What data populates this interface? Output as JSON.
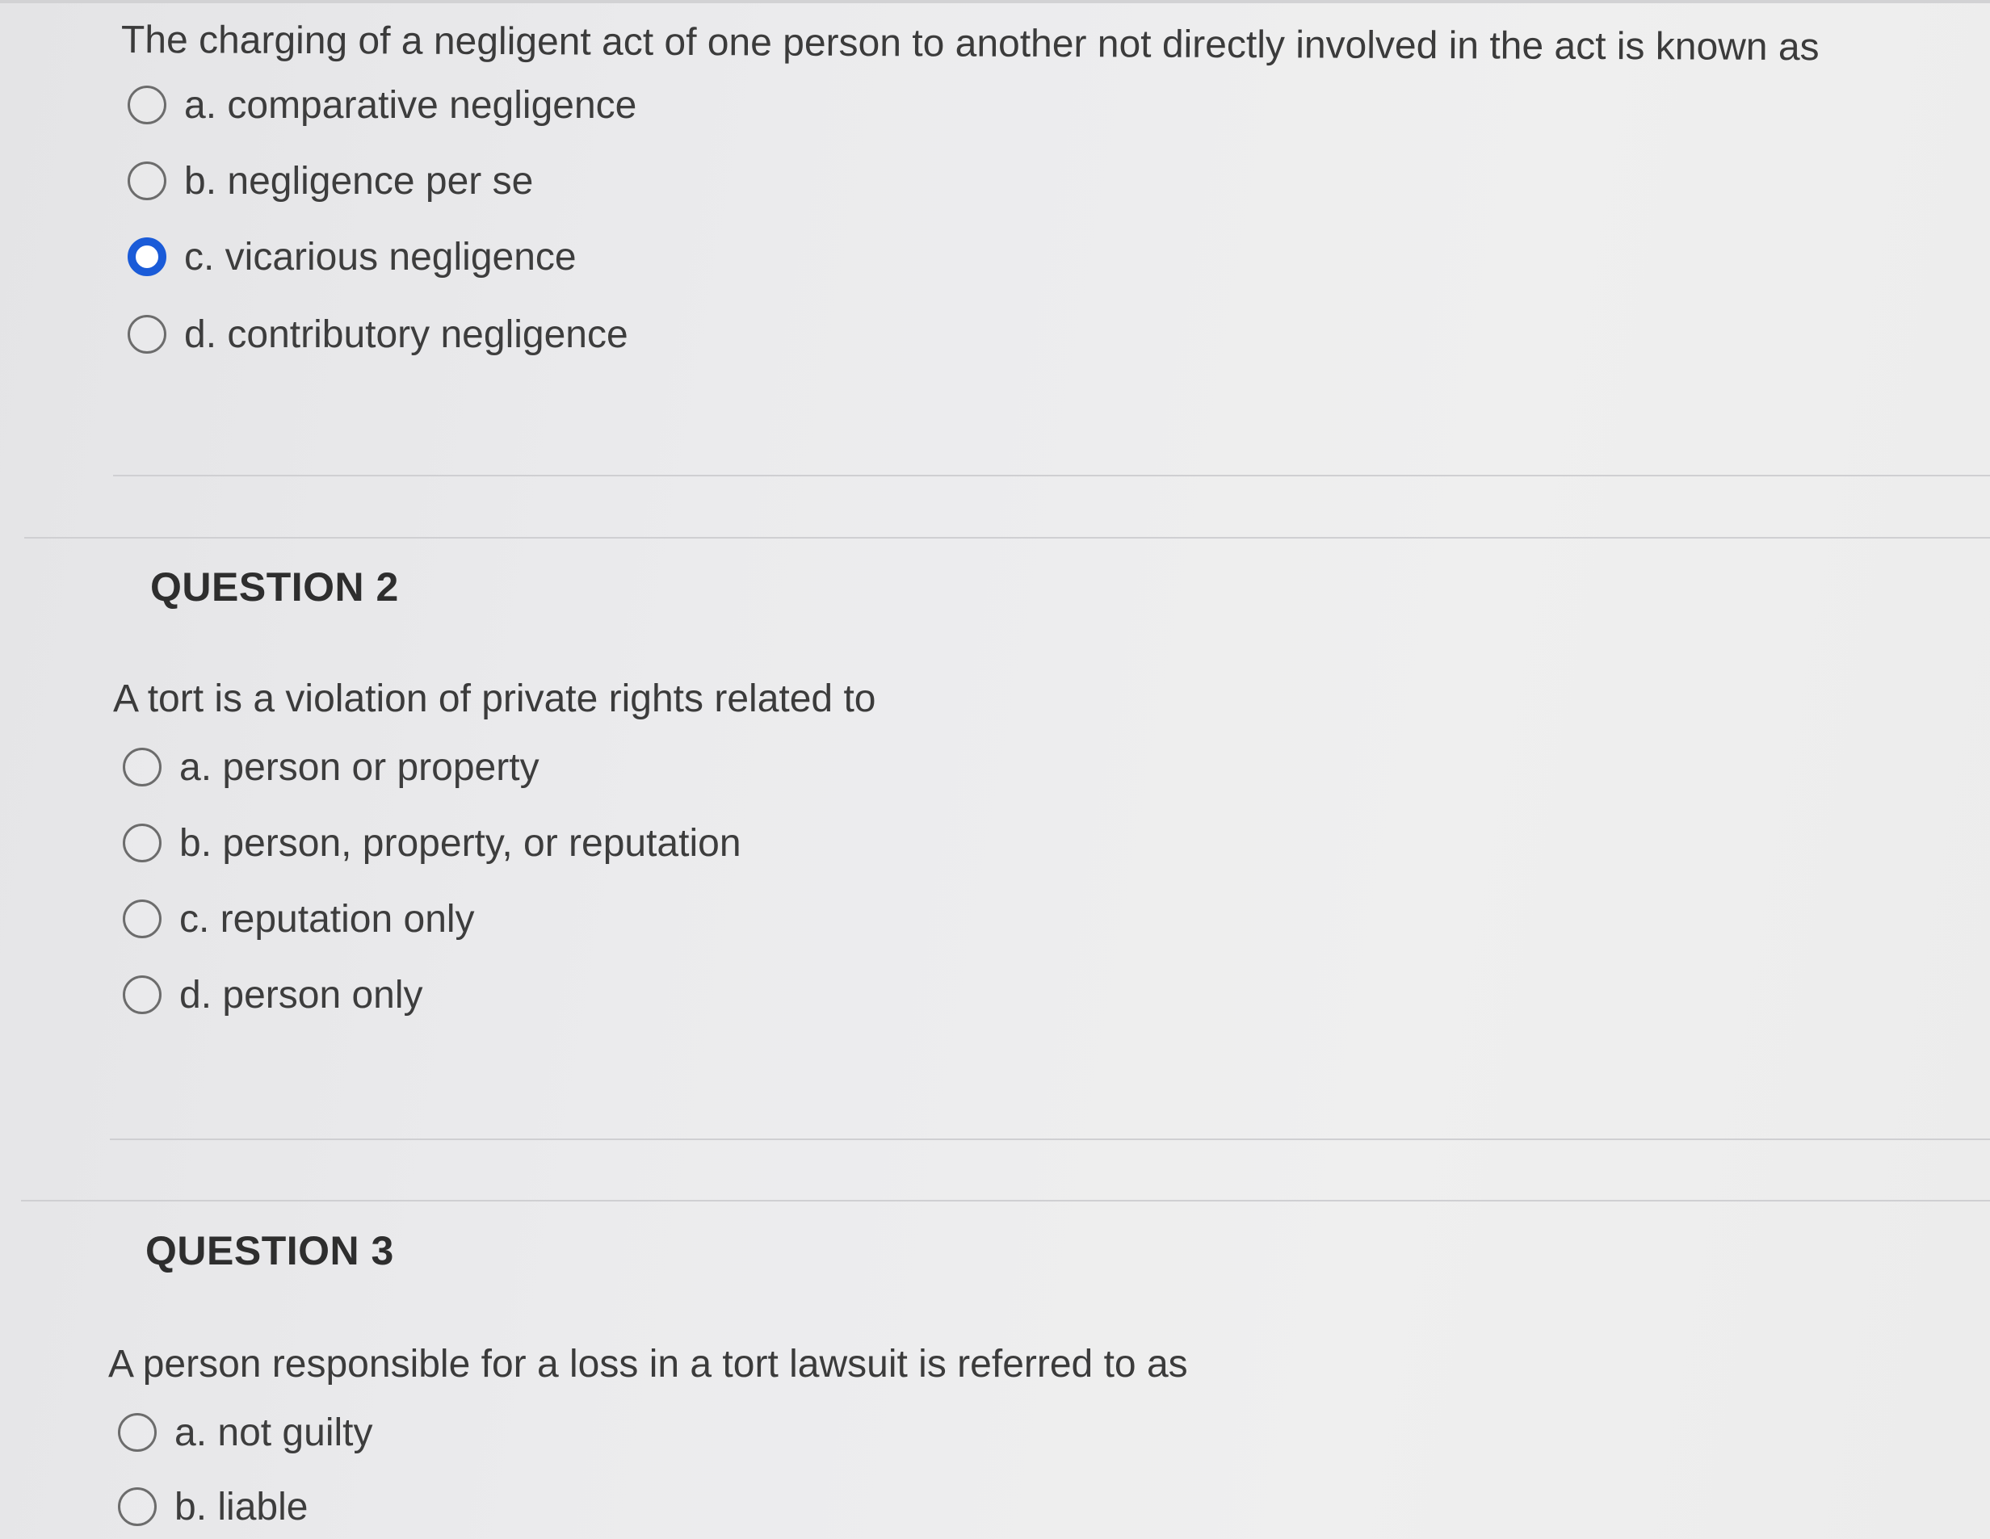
{
  "questions": [
    {
      "heading": "",
      "text": "The charging of a negligent act of one person to another not directly involved in the act is known as",
      "options": [
        {
          "label": "a. comparative negligence",
          "selected": false
        },
        {
          "label": "b. negligence per se",
          "selected": false
        },
        {
          "label": "c. vicarious negligence",
          "selected": true
        },
        {
          "label": "d. contributory negligence",
          "selected": false
        }
      ]
    },
    {
      "heading": "QUESTION 2",
      "text": "A tort is a violation of private rights related to",
      "options": [
        {
          "label": "a. person or property",
          "selected": false
        },
        {
          "label": "b. person, property, or reputation",
          "selected": false
        },
        {
          "label": "c. reputation only",
          "selected": false
        },
        {
          "label": "d. person only",
          "selected": false
        }
      ]
    },
    {
      "heading": "QUESTION 3",
      "text": "A person responsible for a loss in a tort lawsuit is referred to as",
      "options": [
        {
          "label": "a. not guilty",
          "selected": false
        },
        {
          "label": "b. liable",
          "selected": false
        }
      ]
    }
  ],
  "colors": {
    "selected_radio": "#1a5bd8",
    "radio_border": "#6c6c6c"
  }
}
